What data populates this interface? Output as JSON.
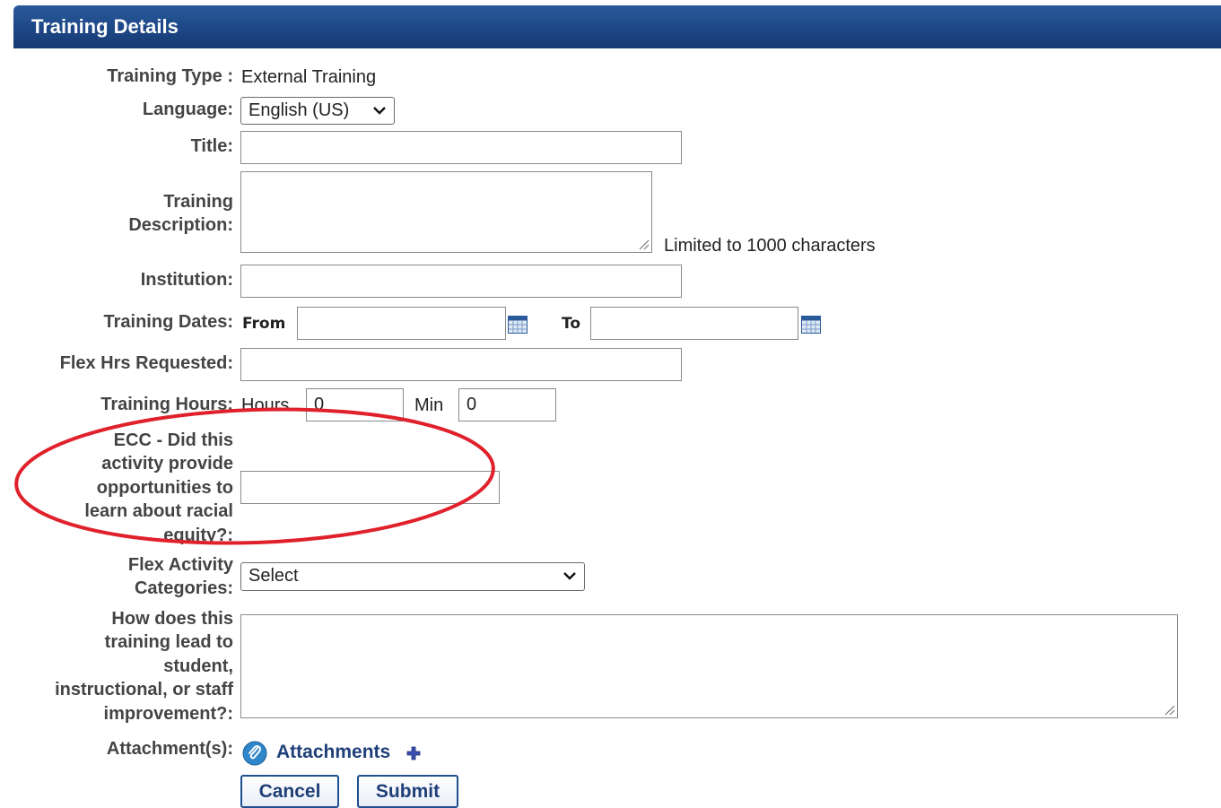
{
  "header": {
    "title": "Training Details"
  },
  "form": {
    "training_type": {
      "label": "Training Type :",
      "value": "External Training"
    },
    "language": {
      "label": "Language:",
      "selected": "English (US)"
    },
    "title": {
      "label": "Title:",
      "value": ""
    },
    "description": {
      "label_line1": "Training",
      "label_line2": "Description:",
      "value": "",
      "note": "Limited to 1000 characters"
    },
    "institution": {
      "label": "Institution:",
      "value": ""
    },
    "training_dates": {
      "label": "Training Dates:",
      "from_label": "From",
      "from_value": "",
      "to_label": "To",
      "to_value": ""
    },
    "flex_hrs": {
      "label": "Flex Hrs Requested:",
      "value": ""
    },
    "training_hours": {
      "label": "Training Hours:",
      "hours_label": "Hours",
      "hours_value": "0",
      "min_label": "Min",
      "min_value": "0"
    },
    "ecc": {
      "label_lines": [
        "ECC - Did this",
        "activity provide",
        "opportunities to",
        "learn about racial",
        "equity?:"
      ],
      "value": ""
    },
    "flex_activity": {
      "label_line1": "Flex Activity",
      "label_line2": "Categories:",
      "selected": "Select"
    },
    "improvement": {
      "label_lines": [
        "How does this",
        "training lead to",
        "student,",
        "instructional, or staff",
        "improvement?:"
      ],
      "value": ""
    },
    "attachments": {
      "label": "Attachment(s):",
      "link": "Attachments"
    }
  },
  "buttons": {
    "cancel": "Cancel",
    "submit": "Submit"
  },
  "colors": {
    "header": "#1d4786",
    "annotation": "#e0212b",
    "button_border": "#1f4f8f"
  },
  "icons": [
    "calendar-icon",
    "chevron-down-icon",
    "paperclip-icon",
    "plus-icon",
    "resize-grip-icon"
  ]
}
